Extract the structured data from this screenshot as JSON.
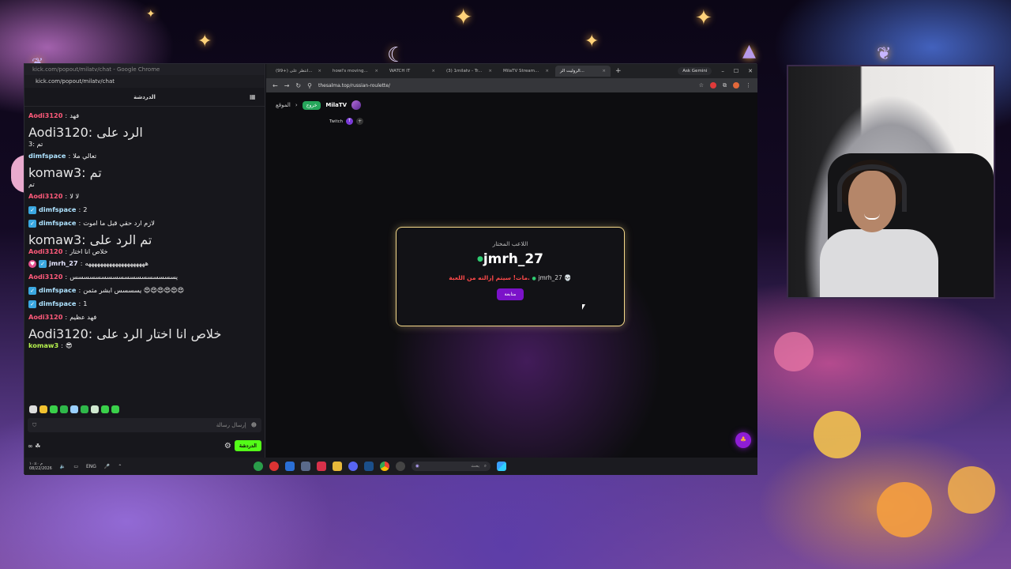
{
  "chat": {
    "window_title": "kick.com/popout/milatv/chat - Google Chrome",
    "url": "kick.com/popout/milatv/chat",
    "header_title": "الدردشة",
    "messages": [
      {
        "user": "Aodi3120",
        "text": "فهد",
        "reply": ""
      },
      {
        "user": "",
        "text": "تم :3",
        "reply": "Aodi3120: الرد على"
      },
      {
        "user": "dimfspace",
        "text": "تعالي ملا",
        "reply": ""
      },
      {
        "user": "",
        "text": "تم",
        "reply": "komaw3: تم"
      },
      {
        "user": "Aodi3120",
        "text": "لا لا",
        "reply": ""
      },
      {
        "user": "dimfspace",
        "text": "2",
        "reply": ""
      },
      {
        "user": "dimfspace",
        "text": "لازم ارد حقي قبل ما اموت",
        "reply": ""
      },
      {
        "user": "Aodi3120",
        "text": "خلاص انا اختار",
        "reply": "komaw3: تم الرد على"
      },
      {
        "user": "jmrh_27",
        "text": "ههههههههههههههههههههه",
        "reply": ""
      },
      {
        "user": "Aodi3120",
        "text": "يسسسسسسسسسسسسسسسسسس",
        "reply": ""
      },
      {
        "user": "dimfspace",
        "text": "يسسسس ابشر مثمن 😍😍😍😍😍😍",
        "reply": ""
      },
      {
        "user": "dimfspace",
        "text": "1",
        "reply": ""
      },
      {
        "user": "Aodi3120",
        "text": "فهد عظيم",
        "reply": ""
      },
      {
        "user": "komaw3",
        "text": "😎",
        "reply": "Aodi3120: خلاص انا اختار الرد على"
      }
    ],
    "input_placeholder": "إرسال رسالة",
    "send_label": "الدردشة",
    "footer_left": "∞ ☘"
  },
  "browser": {
    "tabs": [
      {
        "label": "(99+) انتظر على..."
      },
      {
        "label": "howl's moving..."
      },
      {
        "label": "WATCH IT"
      },
      {
        "label": "(3) 1milatv - Tr..."
      },
      {
        "label": "MilaTV Stream..."
      },
      {
        "label": "الروليت الر..."
      }
    ],
    "ask_gemini": "Ask Gemini",
    "url": "thesalma.top/russian-roulette/",
    "site": {
      "back_label": "الموقع",
      "exit_label": "خروج",
      "username": "MilaTV",
      "twitch_label": "Twitch"
    },
    "modal": {
      "label": "اللاعب المختار",
      "player": "jmrh_27",
      "result_text": "مات! سيتم إزالته من اللعبة.",
      "result_name": "jmrh_27",
      "continue_label": "متابعة"
    }
  },
  "taskbar": {
    "time": "م ١٠:٤٠",
    "date": "08/22/2026",
    "lang": "ENG",
    "search_label": "بحث"
  },
  "colors": {
    "kick_green": "#53fc18",
    "modal_border": "#f5d98a",
    "continue_button": "#7b12c9",
    "death_text": "#ff4a4a"
  }
}
